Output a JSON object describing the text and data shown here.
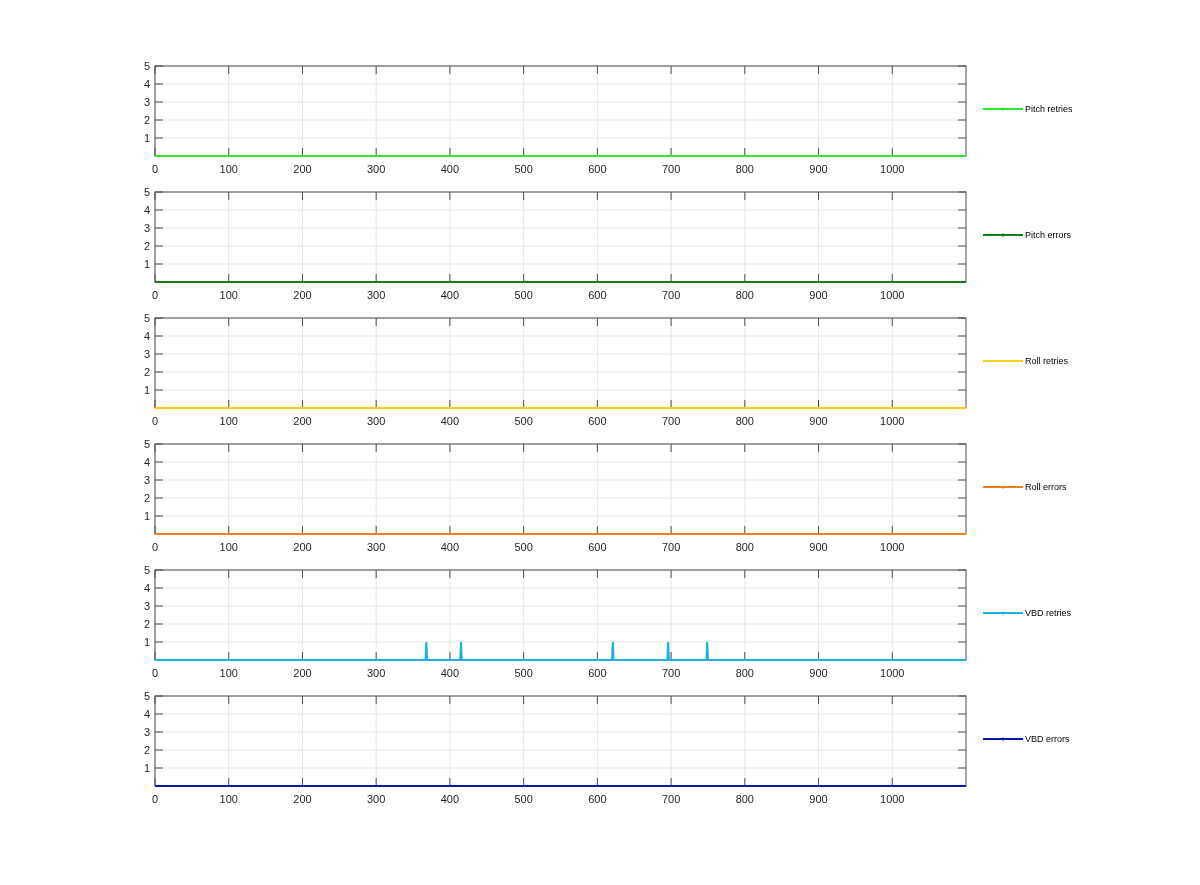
{
  "panels": [
    {
      "chart_data": {
        "type": "line",
        "x": [
          0,
          1100
        ],
        "grid": true,
        "series": [
          {
            "name": "Pitch retries",
            "color": "#2ee82e",
            "values": [
              0,
              0
            ]
          }
        ],
        "xlim": [
          0,
          1100
        ],
        "ylim": [
          0,
          5
        ],
        "xticks": [
          0,
          100,
          200,
          300,
          400,
          500,
          600,
          700,
          800,
          900,
          1000
        ],
        "yticks": [
          1,
          2,
          3,
          4,
          5
        ]
      }
    },
    {
      "chart_data": {
        "type": "line",
        "x": [
          0,
          1100
        ],
        "grid": true,
        "series": [
          {
            "name": "Pitch errors",
            "color": "#1a7a1a",
            "values": [
              0,
              0
            ]
          }
        ],
        "xlim": [
          0,
          1100
        ],
        "ylim": [
          0,
          5
        ],
        "xticks": [
          0,
          100,
          200,
          300,
          400,
          500,
          600,
          700,
          800,
          900,
          1000
        ],
        "yticks": [
          1,
          2,
          3,
          4,
          5
        ]
      }
    },
    {
      "chart_data": {
        "type": "line",
        "x": [
          0,
          1100
        ],
        "grid": true,
        "series": [
          {
            "name": "Roll retries",
            "color": "#f2d21a",
            "values": [
              0,
              0
            ]
          }
        ],
        "xlim": [
          0,
          1100
        ],
        "ylim": [
          0,
          5
        ],
        "xticks": [
          0,
          100,
          200,
          300,
          400,
          500,
          600,
          700,
          800,
          900,
          1000
        ],
        "yticks": [
          1,
          2,
          3,
          4,
          5
        ]
      }
    },
    {
      "chart_data": {
        "type": "line",
        "x": [
          0,
          1100
        ],
        "grid": true,
        "series": [
          {
            "name": "Roll errors",
            "color": "#f07f1e",
            "values": [
              0,
              0
            ]
          }
        ],
        "xlim": [
          0,
          1100
        ],
        "ylim": [
          0,
          5
        ],
        "xticks": [
          0,
          100,
          200,
          300,
          400,
          500,
          600,
          700,
          800,
          900,
          1000
        ],
        "yticks": [
          1,
          2,
          3,
          4,
          5
        ]
      }
    },
    {
      "chart_data": {
        "type": "line",
        "x": [
          0,
          367,
          368,
          369,
          414,
          415,
          416,
          620,
          621,
          622,
          695,
          696,
          697,
          748,
          749,
          750,
          1100
        ],
        "grid": true,
        "series": [
          {
            "name": "VBD retries",
            "color": "#1ab0e0",
            "values": [
              0,
              0,
              1,
              0,
              0,
              1,
              0,
              0,
              1,
              0,
              0,
              1,
              0,
              0,
              1,
              0,
              0
            ]
          }
        ],
        "xlim": [
          0,
          1100
        ],
        "ylim": [
          0,
          5
        ],
        "xticks": [
          0,
          100,
          200,
          300,
          400,
          500,
          600,
          700,
          800,
          900,
          1000
        ],
        "yticks": [
          1,
          2,
          3,
          4,
          5
        ]
      }
    },
    {
      "chart_data": {
        "type": "line",
        "x": [
          0,
          1100
        ],
        "grid": true,
        "series": [
          {
            "name": "VBD errors",
            "color": "#0a1aa8",
            "values": [
              0,
              0
            ]
          }
        ],
        "xlim": [
          0,
          1100
        ],
        "ylim": [
          0,
          5
        ],
        "xticks": [
          0,
          100,
          200,
          300,
          400,
          500,
          600,
          700,
          800,
          900,
          1000
        ],
        "yticks": [
          1,
          2,
          3,
          4,
          5
        ]
      }
    }
  ]
}
